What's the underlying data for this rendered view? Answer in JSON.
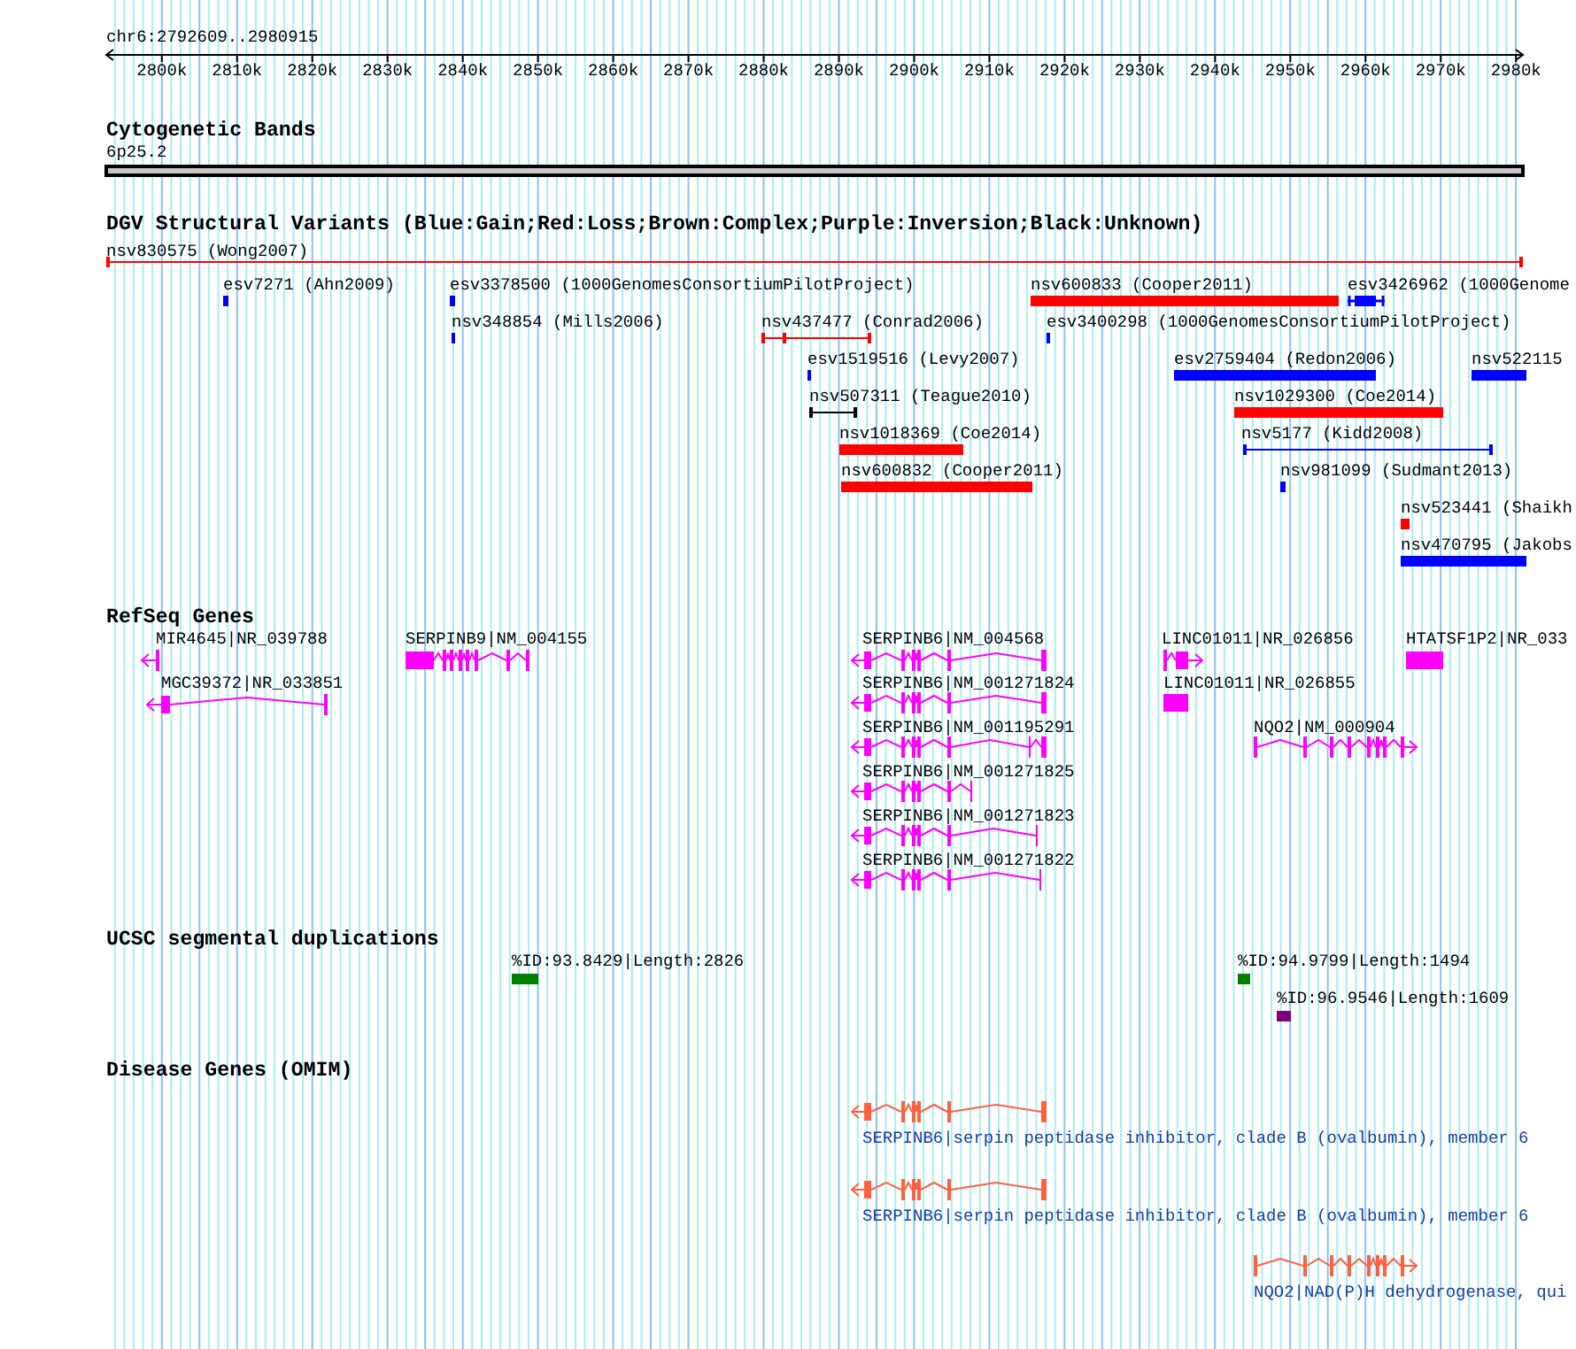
{
  "ruler": {
    "region": "chr6:2792609..2980915",
    "ticks": [
      "2800k",
      "2810k",
      "2820k",
      "2830k",
      "2840k",
      "2850k",
      "2860k",
      "2870k",
      "2880k",
      "2890k",
      "2900k",
      "2910k",
      "2920k",
      "2930k",
      "2940k",
      "2950k",
      "2960k",
      "2970k",
      "2980k"
    ]
  },
  "tracks": [
    {
      "kind": "cytoband",
      "title": "Cytogenetic Bands",
      "band": "6p25.2"
    },
    {
      "kind": "variants",
      "title": "DGV Structural Variants (Blue:Gain;Red:Loss;Brown:Complex;Purple:Inversion;Black:Unknown)",
      "features": [
        {
          "label": "nsv830575 (Wong2007)",
          "kind": "span",
          "color": "#ff0000"
        },
        {
          "label": "esv7271 (Ahn2009)",
          "kind": "block",
          "color": "#0000ff"
        },
        {
          "label": "esv3378500 (1000GenomesConsortiumPilotProject)",
          "kind": "block",
          "color": "#0000ff"
        },
        {
          "label": "nsv600833 (Cooper2011)",
          "kind": "block",
          "color": "#ff0000"
        },
        {
          "label": "esv3426962 (1000Genome",
          "kind": "capped-block",
          "color": "#0000ff"
        },
        {
          "label": "nsv348854 (Mills2006)",
          "kind": "block",
          "color": "#0000ff"
        },
        {
          "label": "nsv437477 (Conrad2006)",
          "kind": "span",
          "color": "#ff0000"
        },
        {
          "label": "esv3400298 (1000GenomesConsortiumPilotProject)",
          "kind": "block",
          "color": "#0000ff"
        },
        {
          "label": "esv1519516 (Levy2007)",
          "kind": "block",
          "color": "#0000ff"
        },
        {
          "label": "esv2759404 (Redon2006)",
          "kind": "block",
          "color": "#0000ff"
        },
        {
          "label": "nsv522115",
          "kind": "block",
          "color": "#0000ff"
        },
        {
          "label": "nsv507311 (Teague2010)",
          "kind": "span",
          "color": "#000000"
        },
        {
          "label": "nsv1029300 (Coe2014)",
          "kind": "block",
          "color": "#ff0000"
        },
        {
          "label": "nsv1018369 (Coe2014)",
          "kind": "block",
          "color": "#ff0000"
        },
        {
          "label": "nsv5177 (Kidd2008)",
          "kind": "span",
          "color": "#0000ff"
        },
        {
          "label": "nsv600832 (Cooper2011)",
          "kind": "block",
          "color": "#ff0000"
        },
        {
          "label": "nsv981099 (Sudmant2013)",
          "kind": "block",
          "color": "#0000ff"
        },
        {
          "label": "nsv523441 (Shaikh",
          "kind": "block",
          "color": "#ff0000"
        },
        {
          "label": "nsv470795 (Jakobs",
          "kind": "block",
          "color": "#0000ff"
        }
      ]
    },
    {
      "kind": "genes",
      "title": "RefSeq Genes",
      "features": [
        {
          "label": "MIR4645|NR_039788",
          "reverse": true
        },
        {
          "label": "SERPINB9|NM_004155"
        },
        {
          "label": "SERPINB6|NM_004568",
          "reverse": true
        },
        {
          "label": "LINC01011|NR_026856",
          "reverse": false
        },
        {
          "label": "HTATSF1P2|NR_033"
        },
        {
          "label": "MGC39372|NR_033851",
          "reverse": true
        },
        {
          "label": "SERPINB6|NM_001271824",
          "reverse": true
        },
        {
          "label": "LINC01011|NR_026855"
        },
        {
          "label": "SERPINB6|NM_001195291",
          "reverse": true
        },
        {
          "label": "NQO2|NM_000904",
          "reverse": false
        },
        {
          "label": "SERPINB6|NM_001271825",
          "reverse": true
        },
        {
          "label": "SERPINB6|NM_001271823",
          "reverse": true
        },
        {
          "label": "SERPINB6|NM_001271822",
          "reverse": true
        }
      ]
    },
    {
      "kind": "duplications",
      "title": "UCSC segmental duplications",
      "features": [
        {
          "label": "%ID:93.8429|Length:2826",
          "color": "#008000"
        },
        {
          "label": "%ID:94.9799|Length:1494",
          "color": "#008000"
        },
        {
          "label": "%ID:96.9546|Length:1609",
          "color": "#800080"
        }
      ]
    },
    {
      "kind": "omim",
      "title": "Disease Genes (OMIM)",
      "features": [
        {
          "label": "SERPINB6|serpin peptidase inhibitor, clade B (ovalbumin), member 6",
          "reverse": true
        },
        {
          "label": "SERPINB6|serpin peptidase inhibitor, clade B (ovalbumin), member 6",
          "reverse": true
        },
        {
          "label": "NQO2|NAD(P)H dehydrogenase, qui",
          "reverse": false
        }
      ]
    }
  ]
}
